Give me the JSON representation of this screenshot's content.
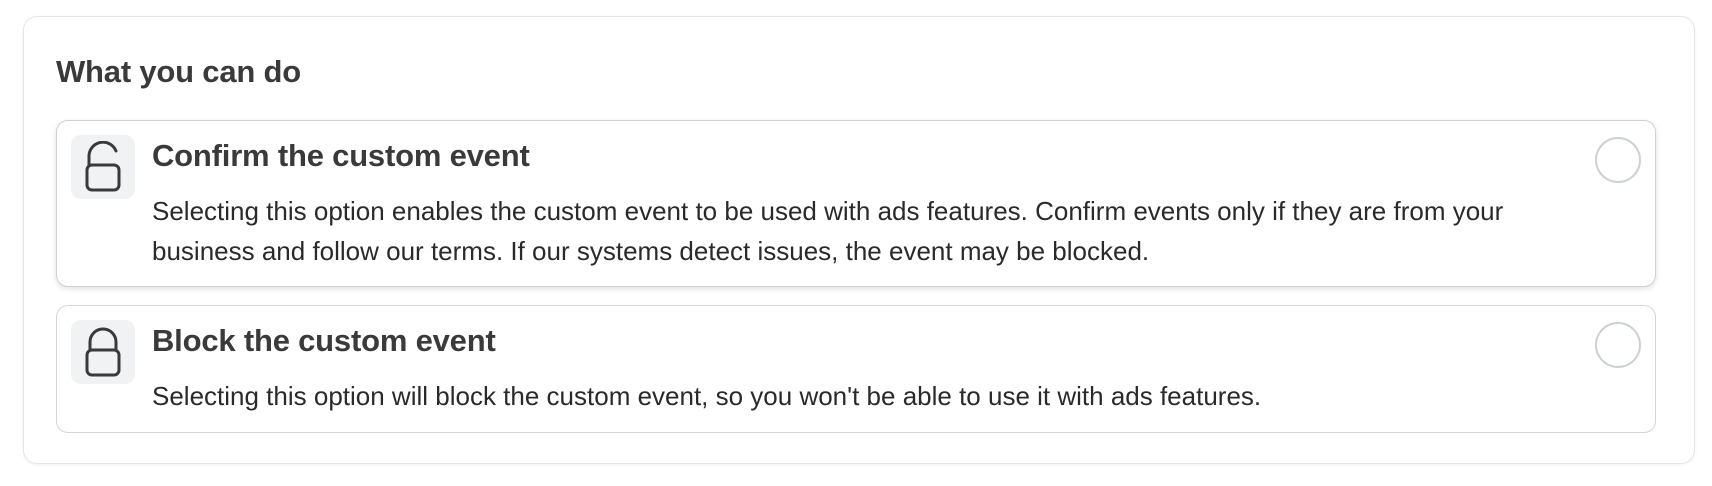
{
  "section": {
    "title": "What you can do"
  },
  "options": [
    {
      "id": "confirm",
      "icon": "unlocked-lock-icon",
      "title": "Confirm the custom event",
      "description": "Selecting this option enables the custom event to be used with ads features. Confirm events only if they are from your business and follow our terms. If our systems detect issues, the event may be blocked.",
      "selected": false
    },
    {
      "id": "block",
      "icon": "locked-lock-icon",
      "title": "Block the custom event",
      "description": "Selecting this option will block the custom event, so you won't be able to use it with ads features.",
      "selected": false
    }
  ],
  "colors": {
    "text": "#3a3a3a",
    "icon_bg": "#f1f2f3",
    "border": "#d3d5d8",
    "radio_border": "#cdd0d4"
  }
}
